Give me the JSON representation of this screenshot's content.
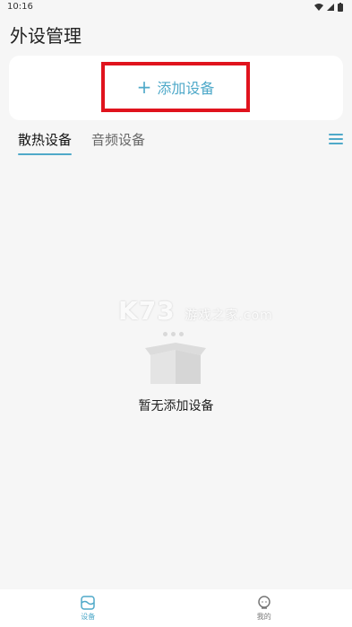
{
  "status_bar": {
    "time": "10:16"
  },
  "header": {
    "title": "外设管理"
  },
  "add_device": {
    "label": "添加设备",
    "plus": "+"
  },
  "tabs": [
    {
      "label": "散热设备",
      "active": true
    },
    {
      "label": "音频设备",
      "active": false
    }
  ],
  "empty_state": {
    "message": "暂无添加设备"
  },
  "watermark": {
    "brand": "K73",
    "text": "游戏之家",
    "domain": ".com"
  },
  "bottom_nav": [
    {
      "label": "设备",
      "icon": "device-icon",
      "active": true
    },
    {
      "label": "我的",
      "icon": "profile-icon",
      "active": false
    }
  ],
  "colors": {
    "accent": "#4fa9c9",
    "highlight": "#e0131d",
    "background": "#f6f6f6"
  }
}
